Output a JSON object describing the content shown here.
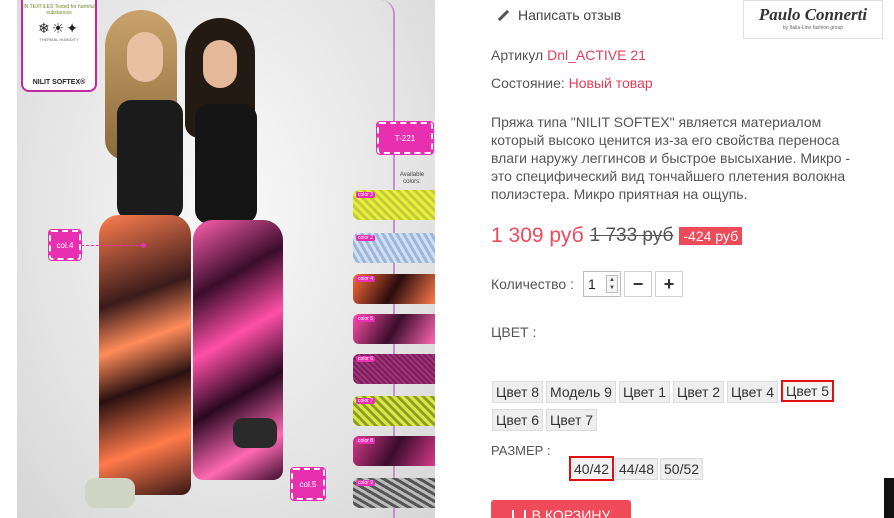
{
  "image": {
    "info_card": {
      "top_text": "IN TEXTILES Tested for harmful substances",
      "icons_sub": "THERMAL  HUMIDITY",
      "brand": "NILIT SOFTEX®"
    },
    "callouts": {
      "col4": "col.4",
      "col5": "col.5",
      "model": "T-221"
    },
    "available_colors": "Available colors:",
    "swatches": [
      "color 3",
      "color 2",
      "color 4",
      "color 5",
      "color 6",
      "color 7",
      "color 8",
      "color 9"
    ]
  },
  "review": {
    "label": "Написать отзыв",
    "icon": "pencil-icon"
  },
  "brand_logo": {
    "name": "Paulo Connerti",
    "tagline": "by Italia-Line fashion group"
  },
  "sku": {
    "label": "Артикул",
    "value": "Dnl_ACTIVE 21"
  },
  "condition": {
    "label": "Состояние:",
    "value": "Новый товар"
  },
  "description": "Пряжа типа \"NILIT SOFTEX\" является материалом который высоко ценится из-за его свойства переноса влаги наружу леггинсов и быстрое высыхание. Микро - это специфический вид тончайшего плетения волокна полиэстера. Микро приятная на ощупь.",
  "price": {
    "current": "1 309 руб",
    "old": "1 733 руб",
    "discount": "-424 руб"
  },
  "quantity": {
    "label": "Количество :",
    "value": "1",
    "minus": "−",
    "plus": "+"
  },
  "colors": {
    "label": "ЦВЕТ :",
    "options": [
      "Цвет 8",
      "Модель 9",
      "Цвет 1",
      "Цвет 2",
      "Цвет 4",
      "Цвет 5",
      "Цвет 6",
      "Цвет 7"
    ],
    "selected": "Цвет 5"
  },
  "sizes": {
    "label": "РАЗМЕР :",
    "options": [
      "40/42",
      "44/48",
      "50/52"
    ],
    "selected": "40/42"
  },
  "cart": {
    "label": "В КОРЗИНУ"
  },
  "accent_color": "#ef4a5a",
  "selection_color": "#e01010"
}
